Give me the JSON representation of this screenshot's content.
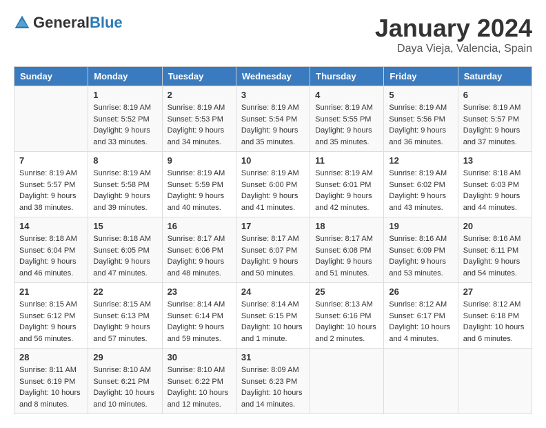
{
  "header": {
    "logo_general": "General",
    "logo_blue": "Blue",
    "month_title": "January 2024",
    "location": "Daya Vieja, Valencia, Spain"
  },
  "weekdays": [
    "Sunday",
    "Monday",
    "Tuesday",
    "Wednesday",
    "Thursday",
    "Friday",
    "Saturday"
  ],
  "weeks": [
    [
      {
        "day": "",
        "info": ""
      },
      {
        "day": "1",
        "info": "Sunrise: 8:19 AM\nSunset: 5:52 PM\nDaylight: 9 hours\nand 33 minutes."
      },
      {
        "day": "2",
        "info": "Sunrise: 8:19 AM\nSunset: 5:53 PM\nDaylight: 9 hours\nand 34 minutes."
      },
      {
        "day": "3",
        "info": "Sunrise: 8:19 AM\nSunset: 5:54 PM\nDaylight: 9 hours\nand 35 minutes."
      },
      {
        "day": "4",
        "info": "Sunrise: 8:19 AM\nSunset: 5:55 PM\nDaylight: 9 hours\nand 35 minutes."
      },
      {
        "day": "5",
        "info": "Sunrise: 8:19 AM\nSunset: 5:56 PM\nDaylight: 9 hours\nand 36 minutes."
      },
      {
        "day": "6",
        "info": "Sunrise: 8:19 AM\nSunset: 5:57 PM\nDaylight: 9 hours\nand 37 minutes."
      }
    ],
    [
      {
        "day": "7",
        "info": "Sunrise: 8:19 AM\nSunset: 5:57 PM\nDaylight: 9 hours\nand 38 minutes."
      },
      {
        "day": "8",
        "info": "Sunrise: 8:19 AM\nSunset: 5:58 PM\nDaylight: 9 hours\nand 39 minutes."
      },
      {
        "day": "9",
        "info": "Sunrise: 8:19 AM\nSunset: 5:59 PM\nDaylight: 9 hours\nand 40 minutes."
      },
      {
        "day": "10",
        "info": "Sunrise: 8:19 AM\nSunset: 6:00 PM\nDaylight: 9 hours\nand 41 minutes."
      },
      {
        "day": "11",
        "info": "Sunrise: 8:19 AM\nSunset: 6:01 PM\nDaylight: 9 hours\nand 42 minutes."
      },
      {
        "day": "12",
        "info": "Sunrise: 8:19 AM\nSunset: 6:02 PM\nDaylight: 9 hours\nand 43 minutes."
      },
      {
        "day": "13",
        "info": "Sunrise: 8:18 AM\nSunset: 6:03 PM\nDaylight: 9 hours\nand 44 minutes."
      }
    ],
    [
      {
        "day": "14",
        "info": "Sunrise: 8:18 AM\nSunset: 6:04 PM\nDaylight: 9 hours\nand 46 minutes."
      },
      {
        "day": "15",
        "info": "Sunrise: 8:18 AM\nSunset: 6:05 PM\nDaylight: 9 hours\nand 47 minutes."
      },
      {
        "day": "16",
        "info": "Sunrise: 8:17 AM\nSunset: 6:06 PM\nDaylight: 9 hours\nand 48 minutes."
      },
      {
        "day": "17",
        "info": "Sunrise: 8:17 AM\nSunset: 6:07 PM\nDaylight: 9 hours\nand 50 minutes."
      },
      {
        "day": "18",
        "info": "Sunrise: 8:17 AM\nSunset: 6:08 PM\nDaylight: 9 hours\nand 51 minutes."
      },
      {
        "day": "19",
        "info": "Sunrise: 8:16 AM\nSunset: 6:09 PM\nDaylight: 9 hours\nand 53 minutes."
      },
      {
        "day": "20",
        "info": "Sunrise: 8:16 AM\nSunset: 6:11 PM\nDaylight: 9 hours\nand 54 minutes."
      }
    ],
    [
      {
        "day": "21",
        "info": "Sunrise: 8:15 AM\nSunset: 6:12 PM\nDaylight: 9 hours\nand 56 minutes."
      },
      {
        "day": "22",
        "info": "Sunrise: 8:15 AM\nSunset: 6:13 PM\nDaylight: 9 hours\nand 57 minutes."
      },
      {
        "day": "23",
        "info": "Sunrise: 8:14 AM\nSunset: 6:14 PM\nDaylight: 9 hours\nand 59 minutes."
      },
      {
        "day": "24",
        "info": "Sunrise: 8:14 AM\nSunset: 6:15 PM\nDaylight: 10 hours\nand 1 minute."
      },
      {
        "day": "25",
        "info": "Sunrise: 8:13 AM\nSunset: 6:16 PM\nDaylight: 10 hours\nand 2 minutes."
      },
      {
        "day": "26",
        "info": "Sunrise: 8:12 AM\nSunset: 6:17 PM\nDaylight: 10 hours\nand 4 minutes."
      },
      {
        "day": "27",
        "info": "Sunrise: 8:12 AM\nSunset: 6:18 PM\nDaylight: 10 hours\nand 6 minutes."
      }
    ],
    [
      {
        "day": "28",
        "info": "Sunrise: 8:11 AM\nSunset: 6:19 PM\nDaylight: 10 hours\nand 8 minutes."
      },
      {
        "day": "29",
        "info": "Sunrise: 8:10 AM\nSunset: 6:21 PM\nDaylight: 10 hours\nand 10 minutes."
      },
      {
        "day": "30",
        "info": "Sunrise: 8:10 AM\nSunset: 6:22 PM\nDaylight: 10 hours\nand 12 minutes."
      },
      {
        "day": "31",
        "info": "Sunrise: 8:09 AM\nSunset: 6:23 PM\nDaylight: 10 hours\nand 14 minutes."
      },
      {
        "day": "",
        "info": ""
      },
      {
        "day": "",
        "info": ""
      },
      {
        "day": "",
        "info": ""
      }
    ]
  ]
}
